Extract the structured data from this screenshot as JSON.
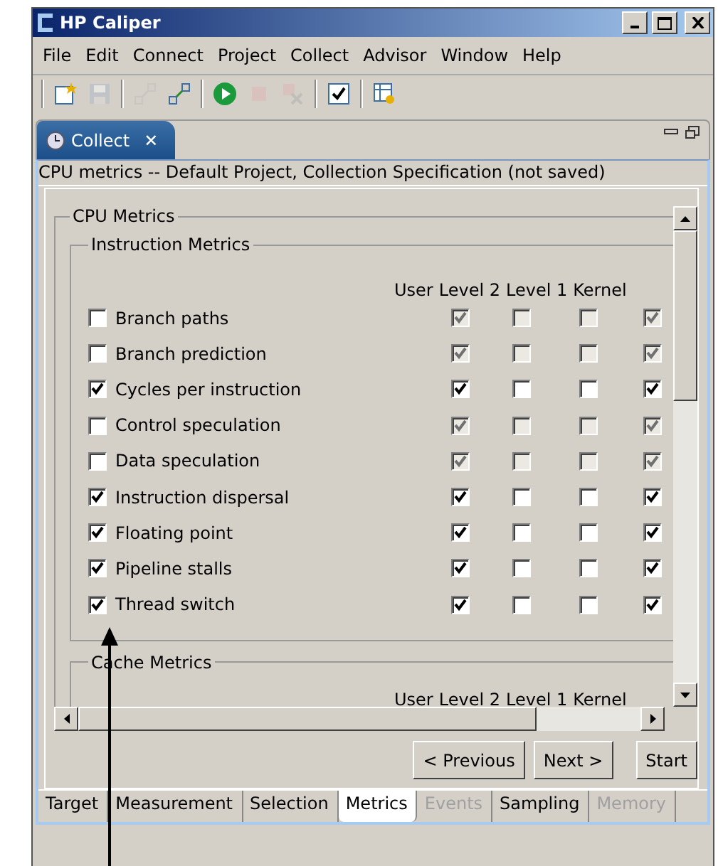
{
  "window": {
    "title": "HP Caliper"
  },
  "menu": [
    "File",
    "Edit",
    "Connect",
    "Project",
    "Collect",
    "Advisor",
    "Window",
    "Help"
  ],
  "toolbar": [
    {
      "items": [
        {
          "kind": "new",
          "disabled": false
        },
        {
          "kind": "save",
          "disabled": true
        }
      ]
    },
    {
      "items": [
        {
          "kind": "connect",
          "disabled": true
        },
        {
          "kind": "connect",
          "disabled": false
        }
      ]
    },
    {
      "items": [
        {
          "kind": "run",
          "disabled": false
        },
        {
          "kind": "stop",
          "disabled": true
        },
        {
          "kind": "cancel",
          "disabled": true
        }
      ]
    },
    {
      "items": [
        {
          "kind": "check",
          "disabled": false
        }
      ]
    },
    {
      "items": [
        {
          "kind": "table",
          "disabled": false
        }
      ]
    }
  ],
  "view_tab": {
    "label": "Collect",
    "close": "✕"
  },
  "header": "CPU metrics -- Default Project, Collection Specification  (not saved)",
  "cpu_group": {
    "title": "CPU Metrics",
    "instruction_group": {
      "title": "Instruction Metrics",
      "columns": [
        "User",
        "Level 2",
        "Level 1",
        "Kernel"
      ],
      "rows": [
        {
          "label": "Branch paths",
          "checked": false,
          "levels": [
            true,
            false,
            false,
            true
          ]
        },
        {
          "label": "Branch prediction",
          "checked": false,
          "levels": [
            true,
            false,
            false,
            true
          ]
        },
        {
          "label": "Cycles per instruction",
          "checked": true,
          "levels": [
            true,
            false,
            false,
            true
          ]
        },
        {
          "label": "Control speculation",
          "checked": false,
          "levels": [
            true,
            false,
            false,
            true
          ]
        },
        {
          "label": "Data speculation",
          "checked": false,
          "levels": [
            true,
            false,
            false,
            true
          ]
        },
        {
          "label": "Instruction dispersal",
          "checked": true,
          "levels": [
            true,
            false,
            false,
            true
          ]
        },
        {
          "label": "Floating point",
          "checked": true,
          "levels": [
            true,
            false,
            false,
            true
          ]
        },
        {
          "label": "Pipeline stalls",
          "checked": true,
          "levels": [
            true,
            false,
            false,
            true
          ]
        },
        {
          "label": "Thread switch",
          "checked": true,
          "levels": [
            true,
            false,
            false,
            true
          ]
        }
      ]
    },
    "cache_group": {
      "title": "Cache Metrics",
      "columns": [
        "User",
        "Level 2",
        "Level 1",
        "Kernel"
      ]
    }
  },
  "buttons": [
    {
      "label": "< Previous",
      "kind": "nav"
    },
    {
      "label": "Next >",
      "kind": "nav"
    },
    {
      "label": "Start",
      "kind": "action"
    }
  ],
  "bottom_tabs": [
    {
      "label": "Target",
      "selected": false,
      "disabled": false
    },
    {
      "label": "Measurement",
      "selected": false,
      "disabled": false
    },
    {
      "label": "Selection",
      "selected": false,
      "disabled": false
    },
    {
      "label": "Metrics",
      "selected": true,
      "disabled": false
    },
    {
      "label": "Events",
      "selected": false,
      "disabled": true
    },
    {
      "label": "Sampling",
      "selected": false,
      "disabled": false
    },
    {
      "label": "Memory",
      "selected": false,
      "disabled": true
    }
  ],
  "callout": {
    "kind": "arrow"
  }
}
